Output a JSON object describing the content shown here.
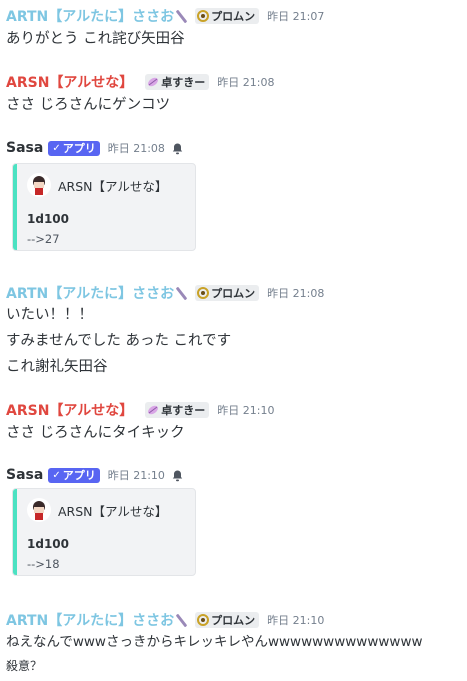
{
  "messages": [
    {
      "author": "ARTN【アルたに】ささお",
      "role": "プロムン",
      "time": "昨日 21:07",
      "lines": [
        "ありがとう これ詫び矢田谷"
      ]
    },
    {
      "author": "ARSN【アルせな】",
      "role": "卓すきー",
      "time": "昨日 21:08",
      "lines": [
        "ささ じろさんにゲンコツ"
      ]
    },
    {
      "author": "Sasa",
      "app_badge": "アプリ",
      "time": "昨日 21:08",
      "embed": {
        "author": "ARSN【アルせな】",
        "title": "1d100",
        "description": "-->27"
      }
    },
    {
      "author": "ARTN【アルたに】ささお",
      "role": "プロムン",
      "time": "昨日 21:08",
      "lines": [
        "いたい！！！",
        "すみませんでした あった これです",
        "これ謝礼矢田谷"
      ]
    },
    {
      "author": "ARSN【アルせな】",
      "role": "卓すきー",
      "time": "昨日 21:10",
      "lines": [
        "ささ じろさんにタイキック"
      ]
    },
    {
      "author": "Sasa",
      "app_badge": "アプリ",
      "time": "昨日 21:10",
      "embed": {
        "author": "ARSN【アルせな】",
        "title": "1d100",
        "description": "-->18"
      }
    },
    {
      "author": "ARTN【アルたに】ささお",
      "role": "プロムン",
      "time": "昨日 21:10",
      "lines": [
        "ねえなんでwwwさっきからキレッキレやんwwwwwwwwwwwwww",
        "殺意？"
      ]
    }
  ],
  "colors": {
    "artn_name": "#7ec6e2",
    "arsn_name": "#e0473f",
    "app_badge": "#5865f2",
    "embed_bar": "#4be2c2"
  },
  "icons": {
    "slash": "diagonal-slash-icon",
    "role_promun": "gold-ring-icon",
    "role_takusuki": "purple-leaf-icon",
    "app_check": "check-icon",
    "bell": "bell-icon"
  }
}
